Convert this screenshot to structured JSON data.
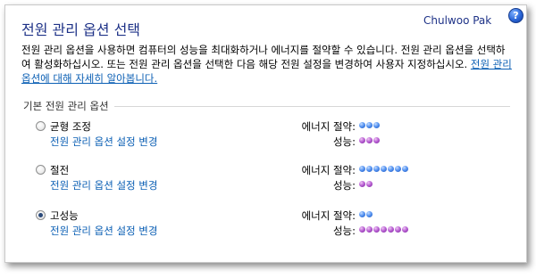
{
  "header": {
    "title": "전원 관리 옵션 선택",
    "author": "Chulwoo Pak",
    "help_icon": "help-icon",
    "help_glyph": "?"
  },
  "description": {
    "text": "전원 관리 옵션을 사용하면 컴퓨터의 성능을 최대화하거나 에너지를 절약할 수 있습니다. 전원 관리 옵션을 선택하여 활성화하십시오. 또는 전원 관리 옵션을 선택한 다음 해당 전원 설정을 변경하여 사용자 지정하십시오.",
    "link": "전원 관리 옵션에 대해 자세히 알아봅니다."
  },
  "section": {
    "label": "기본 전원 관리 옵션"
  },
  "labels": {
    "energy": "에너지 절약:",
    "performance": "성능:"
  },
  "plans": [
    {
      "name": "균형 조정",
      "link": "전원 관리 옵션 설정 변경",
      "selected": false,
      "energy": 3,
      "performance": 3
    },
    {
      "name": "절전",
      "link": "전원 관리 옵션 설정 변경",
      "selected": false,
      "energy": 7,
      "performance": 2
    },
    {
      "name": "고성능",
      "link": "전원 관리 옵션 설정 변경",
      "selected": true,
      "energy": 2,
      "performance": 7
    }
  ],
  "colors": {
    "title": "#1e3287",
    "link": "#0b5fb4",
    "energy_dot": "#4f8ff0",
    "performance_dot": "#b45ad0"
  }
}
